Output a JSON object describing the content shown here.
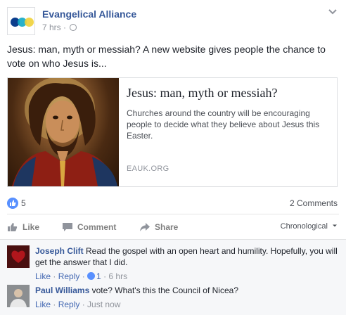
{
  "page": {
    "name": "Evangelical Alliance",
    "time": "7 hrs",
    "separator": "·"
  },
  "post": {
    "text": "Jesus: man, myth or messiah? A new website gives people the chance to vote on who Jesus is..."
  },
  "link": {
    "title": "Jesus: man, myth or messiah?",
    "description": "Churches around the country will be encouraging people to decide what they believe about Jesus this Easter.",
    "domain": "EAUK.ORG"
  },
  "stats": {
    "likes": "5",
    "comments": "2 Comments"
  },
  "actions": {
    "like": "Like",
    "comment": "Comment",
    "share": "Share",
    "order": "Chronological"
  },
  "comments": [
    {
      "author": "Joseph Clift",
      "text": "Read the gospel with an open heart and humility. Hopefully, you will get the answer that I did.",
      "like": "Like",
      "reply": "Reply",
      "likes": "1",
      "time": "6 hrs"
    },
    {
      "author": "Paul Williams",
      "text": "vote? What's this the Council of Nicea?",
      "like": "Like",
      "reply": "Reply",
      "time": "Just now"
    }
  ],
  "colors": {
    "link_blue": "#365899",
    "like_blue": "#5890ff",
    "logo_blue": "#0b3d8c",
    "logo_teal": "#12a8c4",
    "logo_yellow": "#f0d23a"
  }
}
